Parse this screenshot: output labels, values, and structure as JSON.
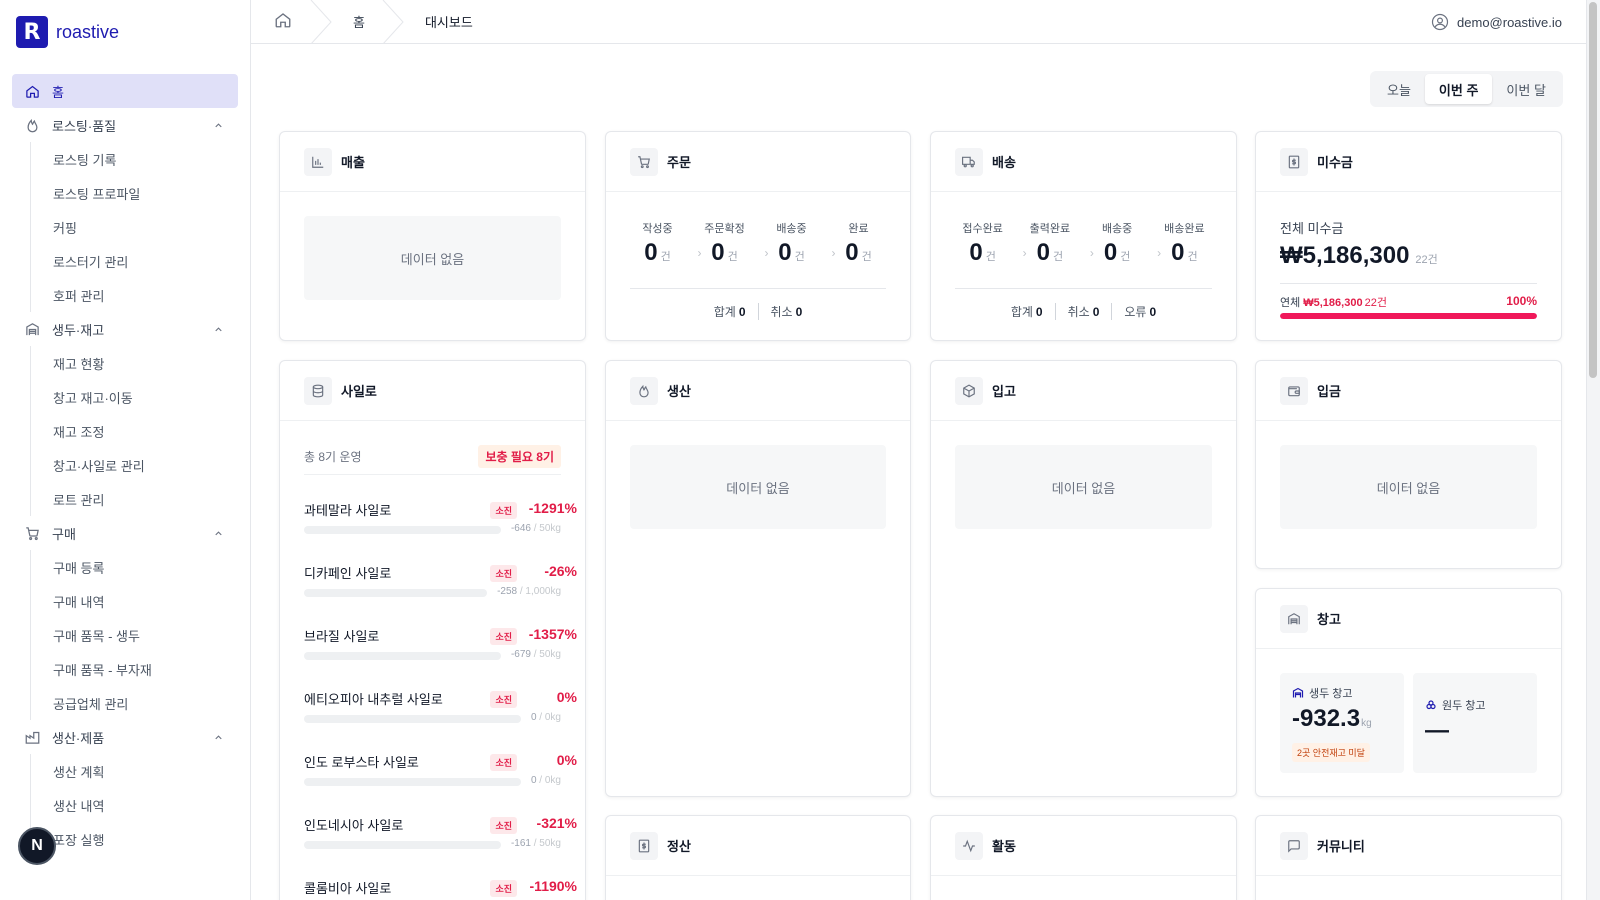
{
  "app": {
    "logo_letter": "R",
    "name": "roastive",
    "accent": "#1e1bb0"
  },
  "topbar": {
    "crumbs": [
      "홈",
      "대시보드"
    ],
    "user_email": "demo@roastive.io"
  },
  "sidebar": {
    "home": "홈",
    "groups": [
      {
        "label": "로스팅·품질",
        "icon": "flame-icon",
        "items": [
          "로스팅 기록",
          "로스팅 프로파일",
          "커핑",
          "로스터기 관리",
          "호퍼 관리"
        ]
      },
      {
        "label": "생두·재고",
        "icon": "warehouse-icon",
        "items": [
          "재고 현황",
          "창고 재고·이동",
          "재고 조정",
          "창고·사일로 관리",
          "로트 관리"
        ]
      },
      {
        "label": "구매",
        "icon": "cart-icon",
        "items": [
          "구매 등록",
          "구매 내역",
          "구매 품목 - 생두",
          "구매 품목 - 부자재",
          "공급업체 관리"
        ]
      },
      {
        "label": "생산·제품",
        "icon": "factory-icon",
        "items": [
          "생산 계획",
          "생산 내역",
          "포장 실행"
        ]
      }
    ],
    "bubble": "N"
  },
  "period": {
    "options": [
      "오늘",
      "이번 주",
      "이번 달"
    ],
    "selected": "이번 주"
  },
  "cards": {
    "sales": {
      "title": "매출",
      "empty": "데이터 없음"
    },
    "orders": {
      "title": "주문",
      "stages": [
        {
          "label": "작성중",
          "value": "0",
          "unit": "건"
        },
        {
          "label": "주문확정",
          "value": "0",
          "unit": "건"
        },
        {
          "label": "배송중",
          "value": "0",
          "unit": "건"
        },
        {
          "label": "완료",
          "value": "0",
          "unit": "건"
        }
      ],
      "totals": [
        {
          "label": "합계",
          "value": "0"
        },
        {
          "label": "취소",
          "value": "0"
        }
      ]
    },
    "delivery": {
      "title": "배송",
      "stages": [
        {
          "label": "접수완료",
          "value": "0",
          "unit": "건"
        },
        {
          "label": "출력완료",
          "value": "0",
          "unit": "건"
        },
        {
          "label": "배송중",
          "value": "0",
          "unit": "건"
        },
        {
          "label": "배송완료",
          "value": "0",
          "unit": "건"
        }
      ],
      "totals": [
        {
          "label": "합계",
          "value": "0"
        },
        {
          "label": "취소",
          "value": "0"
        },
        {
          "label": "오류",
          "value": "0"
        }
      ]
    },
    "receivables": {
      "title": "미수금",
      "total_label": "전체 미수금",
      "total_amount": "₩5,186,300",
      "total_count": "22건",
      "overdue_label": "연체",
      "overdue_amount": "₩5,186,300",
      "overdue_count": "22건",
      "overdue_pct": "100%",
      "overdue_fraction": 1.0,
      "bar_color": "#f0185a"
    },
    "silo": {
      "title": "사일로",
      "summary": "총 8기 운영",
      "refill": "보충 필요 8기",
      "items": [
        {
          "name": "과테말라 사일로",
          "tag": "소진",
          "pct": "-1291%",
          "qty": "-646",
          "cap": " / 50kg"
        },
        {
          "name": "디카페인 사일로",
          "tag": "소진",
          "pct": "-26%",
          "qty": "-258",
          "cap": " / 1,000kg"
        },
        {
          "name": "브라질 사일로",
          "tag": "소진",
          "pct": "-1357%",
          "qty": "-679",
          "cap": " / 50kg"
        },
        {
          "name": "에티오피아 내추럴 사일로",
          "tag": "소진",
          "pct": "0%",
          "qty": "0",
          "cap": " / 0kg"
        },
        {
          "name": "인도 로부스타 사일로",
          "tag": "소진",
          "pct": "0%",
          "qty": "0",
          "cap": " / 0kg"
        },
        {
          "name": "인도네시아 사일로",
          "tag": "소진",
          "pct": "-321%",
          "qty": "-161",
          "cap": " / 50kg"
        },
        {
          "name": "콜롬비아 사일로",
          "tag": "소진",
          "pct": "-1190%",
          "qty": "",
          "cap": ""
        }
      ]
    },
    "production": {
      "title": "생산",
      "empty": "데이터 없음"
    },
    "inbound": {
      "title": "입고",
      "empty": "데이터 없음"
    },
    "deposit": {
      "title": "입금",
      "empty": "데이터 없음"
    },
    "warehouse": {
      "title": "창고",
      "green": {
        "label": "생두 창고",
        "value": "-932.3",
        "unit": "kg",
        "warn": "2곳 안전재고 미달"
      },
      "roasted": {
        "label": "원두 창고",
        "value": "—"
      }
    },
    "settlement": {
      "title": "정산"
    },
    "activity": {
      "title": "활동"
    },
    "community": {
      "title": "커뮤니티"
    }
  }
}
